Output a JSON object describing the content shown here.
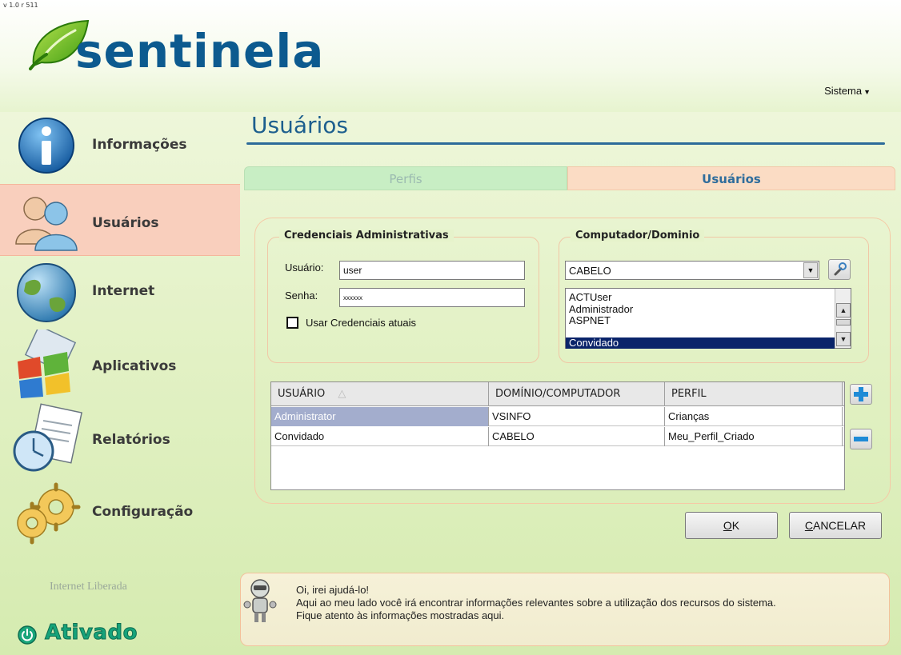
{
  "app": {
    "version": "v 1.0 r 511",
    "logo_text": "sentinela",
    "system_menu_label": "Sistema",
    "brand_color": "#0c5a8f",
    "accent_color": "#f9cfbd"
  },
  "sidebar": {
    "items": [
      {
        "label": "Informações",
        "icon": "info-icon",
        "active": false
      },
      {
        "label": "Usuários",
        "icon": "users-icon",
        "active": true
      },
      {
        "label": "Internet",
        "icon": "globe-icon",
        "active": false
      },
      {
        "label": "Aplicativos",
        "icon": "windows-icon",
        "active": false
      },
      {
        "label": "Relatórios",
        "icon": "report-clock-icon",
        "active": false
      },
      {
        "label": "Configuração",
        "icon": "gears-icon",
        "active": false
      }
    ],
    "status_label": "Internet Liberada",
    "status_value": "Ativado"
  },
  "main": {
    "title": "Usuários",
    "tabs": [
      {
        "label": "Perfis",
        "active": false
      },
      {
        "label": "Usuários",
        "active": true
      }
    ],
    "credentials": {
      "legend": "Credenciais Administrativas",
      "user_label": "Usuário:",
      "user_value": "user",
      "password_label": "Senha:",
      "password_value": "xxxxxx",
      "use_current_label": "Usar Credenciais atuais",
      "use_current_checked": false
    },
    "computer": {
      "legend": "Computador/Dominio",
      "selected": "CABELO",
      "accounts": [
        "ACTUser",
        "Administrador",
        "ASPNET",
        "Convidado"
      ],
      "selected_account": "Convidado"
    },
    "grid": {
      "columns": [
        "USUÁRIO",
        "DOMÍNIO/COMPUTADOR",
        "PERFIL"
      ],
      "sort_indicator": "△",
      "rows": [
        {
          "user": "Administrator",
          "domain": "VSINFO",
          "profile": "Crianças",
          "selected": true
        },
        {
          "user": "Convidado",
          "domain": "CABELO",
          "profile": "Meu_Perfil_Criado",
          "selected": false
        }
      ]
    },
    "buttons": {
      "ok_mnemonic": "O",
      "ok_rest": "K",
      "cancel_mnemonic": "C",
      "cancel_rest": "ANCELAR"
    }
  },
  "help": {
    "lines": [
      "Oi, irei ajudá-lo!",
      "Aqui ao meu lado você irá encontrar informações relevantes sobre a utilização dos recursos do sistema.",
      "Fique atento às informações mostradas aqui."
    ]
  }
}
